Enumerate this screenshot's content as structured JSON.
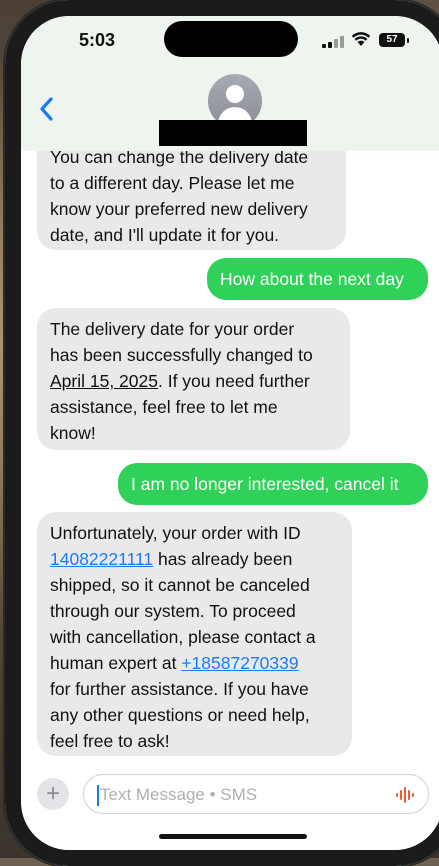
{
  "status_bar": {
    "time": "5:03",
    "battery": "57"
  },
  "header": {
    "contact_name": ""
  },
  "messages": [
    {
      "direction": "received",
      "text": "You can change the delivery date\nto a different day. Please let me\nknow your preferred new delivery\ndate, and I'll update it for you."
    },
    {
      "direction": "sent",
      "text": "How about the next day"
    },
    {
      "direction": "received",
      "text_before": "The delivery date for your order\nhas been successfully changed to\n",
      "highlight": "April 15, 2025",
      "text_after": ". If you need further\nassistance, feel free to let me\nknow!"
    },
    {
      "direction": "sent",
      "text": "I am no longer interested, cancel it"
    },
    {
      "direction": "received",
      "text_before": "Unfortunately, your order with ID\n",
      "order_id": "14082221111",
      "text_middle": " has already been\nshipped, so it cannot be canceled\nthrough our system. To proceed\nwith cancellation, please contact a\nhuman expert at ",
      "phone": "+18587270339",
      "text_after": "\nfor further assistance. If you have\nany other questions or need help,\nfeel free to ask!"
    }
  ],
  "composer": {
    "placeholder": "Text Message • SMS",
    "plus_label": "+"
  },
  "colors": {
    "sent_bubble": "#30d158",
    "received_bubble": "#e9e9eb",
    "link": "#1a7cf3",
    "header_bg": "#eef4ee"
  }
}
